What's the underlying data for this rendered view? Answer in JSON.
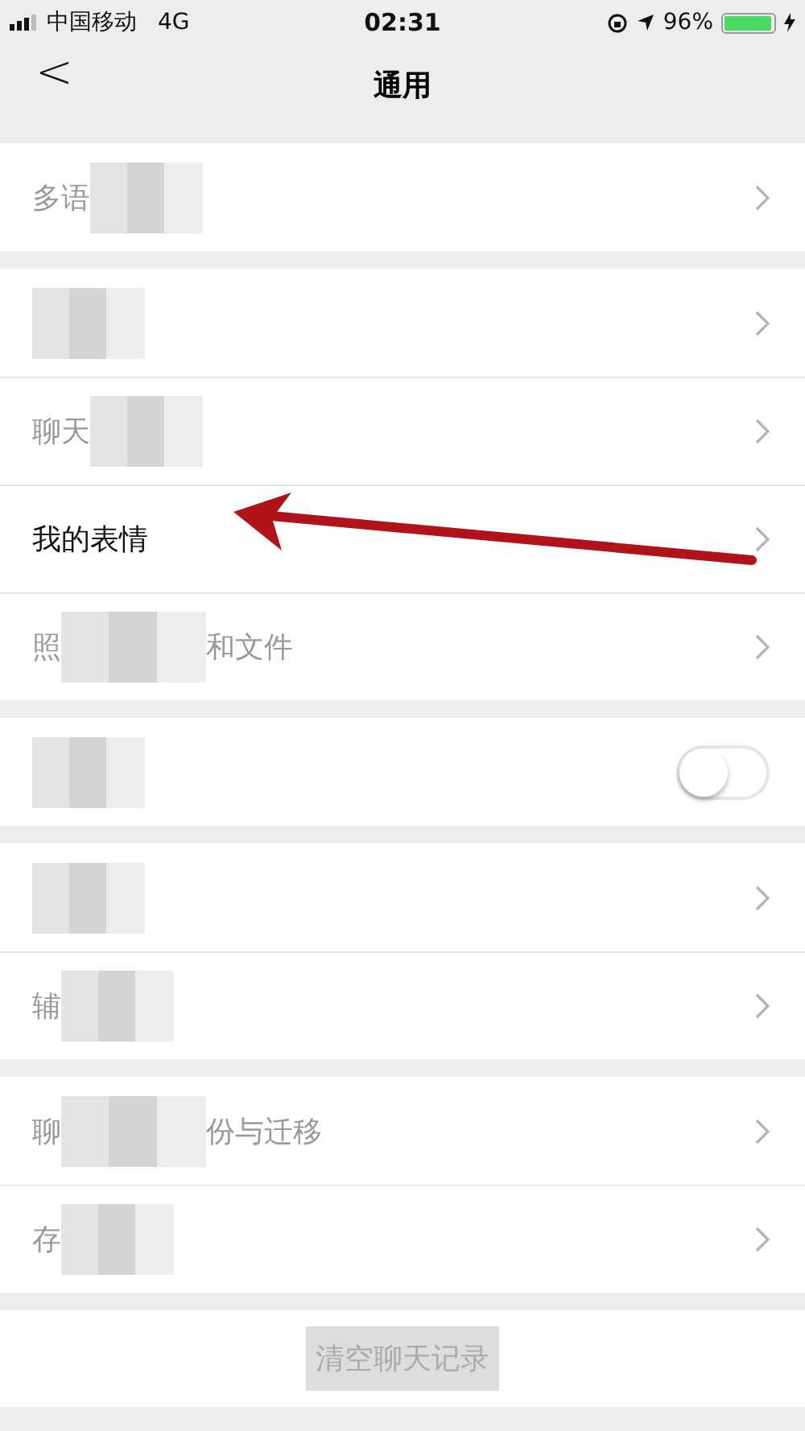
{
  "status_bar": {
    "carrier": "中国移动",
    "network": "4G",
    "time": "02:31",
    "battery": {
      "text": "96%",
      "level": 0.96
    }
  },
  "nav": {
    "back": "<",
    "title": "通用"
  },
  "groups": [
    {
      "rows": [
        {
          "kind": "link",
          "label": "多语",
          "blurred": true
        }
      ]
    },
    {
      "rows": [
        {
          "kind": "link",
          "blurred": true
        },
        {
          "kind": "link",
          "label": "聊天",
          "blurred": true
        },
        {
          "kind": "link",
          "label": "我的表情",
          "blurred": false
        },
        {
          "kind": "link",
          "label": "照",
          "label_tail": "和文件",
          "blurred": true
        }
      ]
    },
    {
      "rows": [
        {
          "kind": "toggle",
          "on": false,
          "blurred": true
        }
      ]
    },
    {
      "rows": [
        {
          "kind": "link",
          "blurred": true
        },
        {
          "kind": "link",
          "label": "辅",
          "blurred": true
        }
      ]
    },
    {
      "rows": [
        {
          "kind": "link",
          "label": "聊",
          "label_tail": "份与迁移",
          "blurred": true
        },
        {
          "kind": "link",
          "label": "存",
          "blurred": true
        }
      ]
    }
  ],
  "clear_button": {
    "label": "清空聊天记录",
    "blurred": true
  }
}
